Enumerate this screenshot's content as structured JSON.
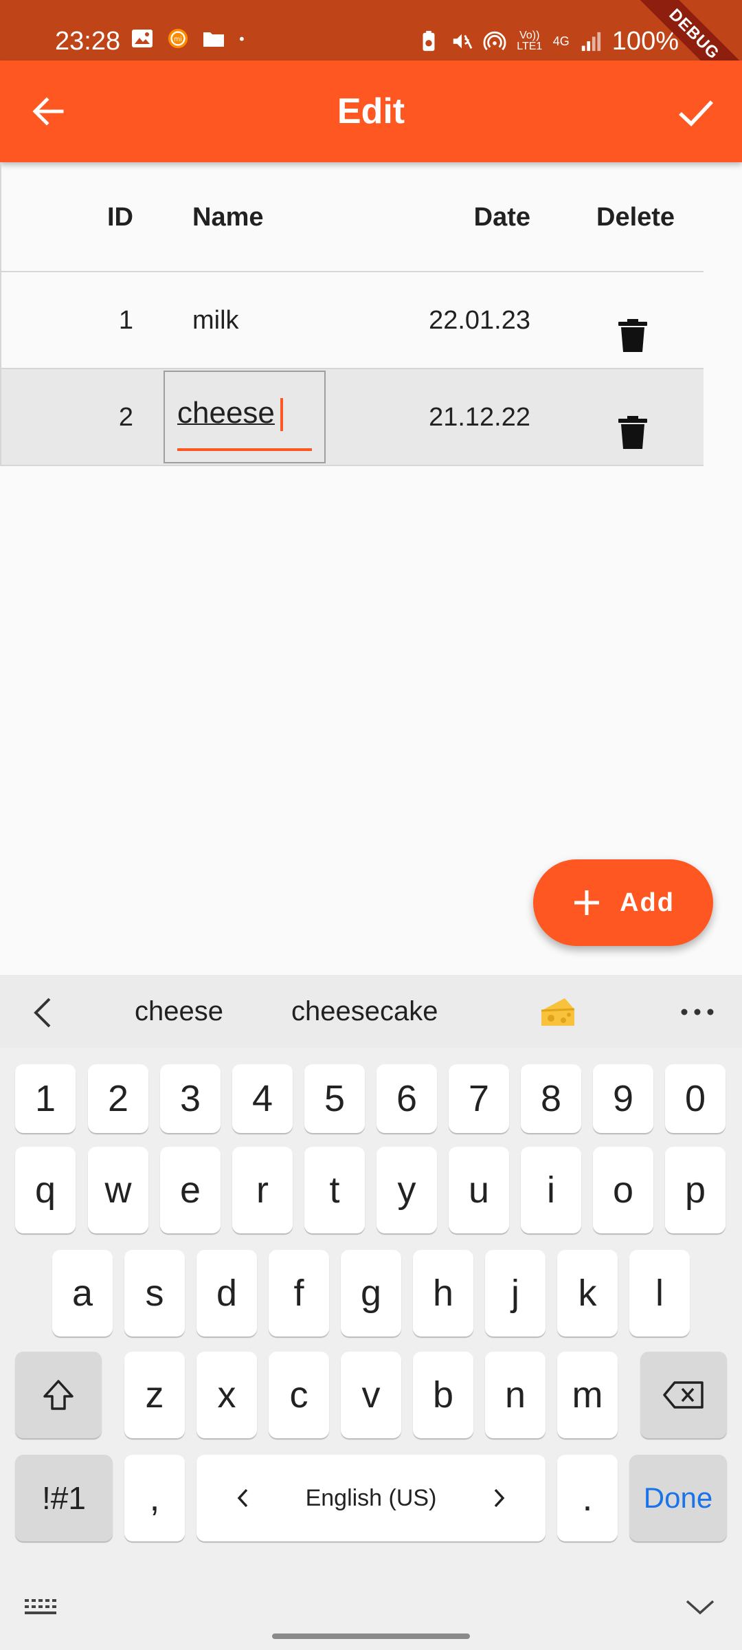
{
  "status_bar": {
    "time": "23:28",
    "battery": "100%",
    "network_labels": [
      "Vo)) LTE1",
      "4G"
    ],
    "left_icons": [
      "image-icon",
      "mi-icon",
      "folder-icon",
      "dot-icon"
    ],
    "right_icons": [
      "battery-saver-icon",
      "mute-icon",
      "hotspot-icon",
      "signal-icon",
      "battery-icon"
    ],
    "debug_label": "DEBUG"
  },
  "app_bar": {
    "title": "Edit",
    "back_icon": "arrow-left-icon",
    "confirm_icon": "check-icon",
    "color": "#FF5722"
  },
  "table": {
    "headers": [
      "ID",
      "Name",
      "Date",
      "Delete"
    ],
    "rows": [
      {
        "id": "1",
        "name": "milk",
        "date": "22.01.23"
      },
      {
        "id": "2",
        "name": "cheese",
        "date": "21.12.22",
        "editing": true
      }
    ]
  },
  "fab": {
    "label": "Add",
    "icon": "plus-icon"
  },
  "keyboard": {
    "suggestions": [
      "cheese",
      "cheesecake"
    ],
    "suggestion_emoji": "cheese-emoji-icon",
    "row_numbers": [
      "1",
      "2",
      "3",
      "4",
      "5",
      "6",
      "7",
      "8",
      "9",
      "0"
    ],
    "row_1": [
      "q",
      "w",
      "e",
      "r",
      "t",
      "y",
      "u",
      "i",
      "o",
      "p"
    ],
    "row_2": [
      "a",
      "s",
      "d",
      "f",
      "g",
      "h",
      "j",
      "k",
      "l"
    ],
    "row_3": [
      "z",
      "x",
      "c",
      "v",
      "b",
      "n",
      "m"
    ],
    "symbols_key": "!#1",
    "comma_key": ",",
    "space_label": "English (US)",
    "period_key": ".",
    "done_key": "Done",
    "accent_color": "#1A73E8"
  }
}
